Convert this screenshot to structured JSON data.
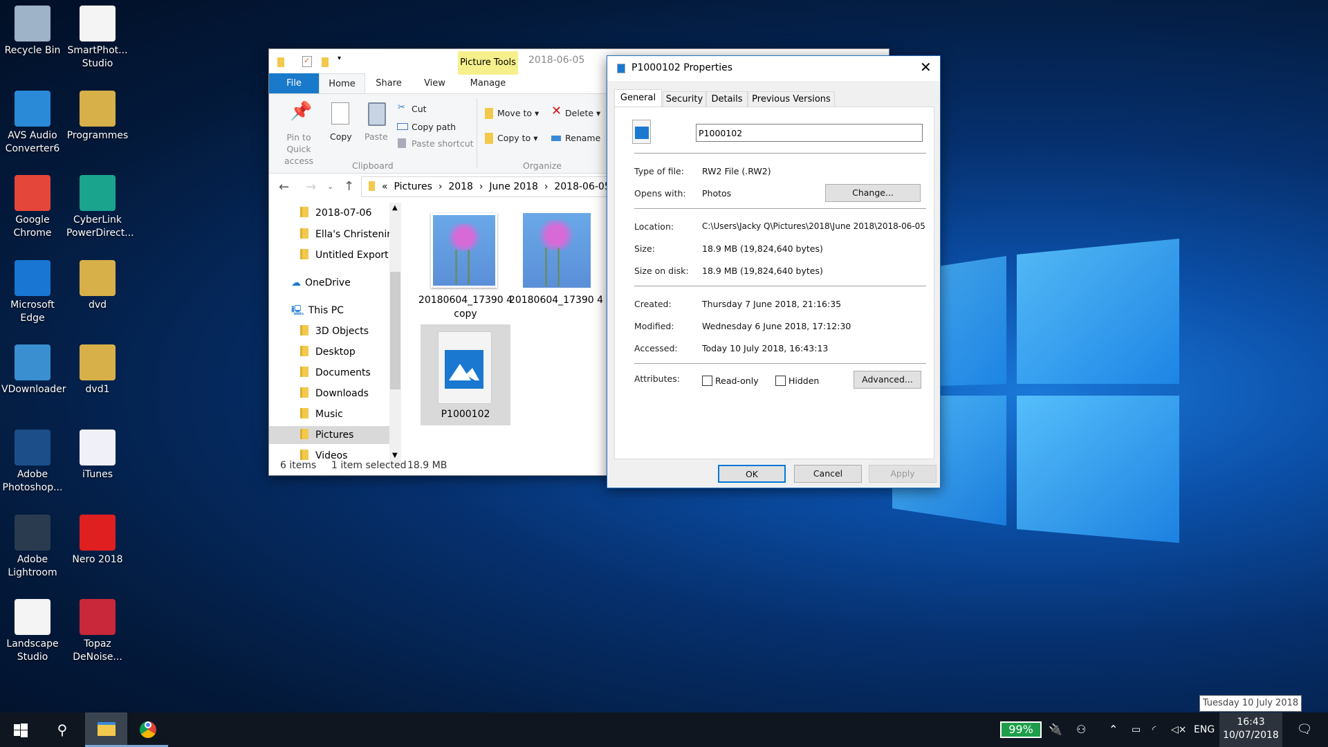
{
  "desktop": {
    "icons": [
      {
        "label": "Recycle Bin",
        "color": "#9fb3c8"
      },
      {
        "label": "SmartPhot... Studio",
        "color": "#f4f4f4"
      },
      {
        "label": "AVS Audio Converter6",
        "color": "#2a8ad8"
      },
      {
        "label": "Programmes",
        "color": "#d8b04a"
      },
      {
        "label": "Google Chrome",
        "color": "#e5463a"
      },
      {
        "label": "CyberLink PowerDirect...",
        "color": "#1aa48e"
      },
      {
        "label": "Microsoft Edge",
        "color": "#1976d2"
      },
      {
        "label": "dvd",
        "color": "#d8b04a"
      },
      {
        "label": "VDownloader",
        "color": "#3a8fd0"
      },
      {
        "label": "dvd1",
        "color": "#d8b04a"
      },
      {
        "label": "Adobe Photoshop...",
        "color": "#1c4f8a"
      },
      {
        "label": "iTunes",
        "color": "#f0f0f8"
      },
      {
        "label": "Adobe Lightroom",
        "color": "#2b3b4f"
      },
      {
        "label": "Nero 2018",
        "color": "#e02020"
      },
      {
        "label": "Landscape Studio",
        "color": "#f4f4f4"
      },
      {
        "label": "Topaz DeNoise...",
        "color": "#c8283a"
      }
    ]
  },
  "explorer": {
    "title": "2018-06-05",
    "context_tab": "Picture Tools",
    "tabs": [
      "File",
      "Home",
      "Share",
      "View",
      "Manage"
    ],
    "ribbon": {
      "pin": "Pin to Quick access",
      "copy": "Copy",
      "paste": "Paste",
      "cut": "Cut",
      "copy_path": "Copy path",
      "paste_shortcut": "Paste shortcut",
      "clipboard": "Clipboard",
      "move_to": "Move to",
      "copy_to": "Copy to",
      "delete": "Delete",
      "rename": "Rename",
      "organize": "Organize"
    },
    "breadcrumb": [
      "Pictures",
      "2018",
      "June 2018",
      "2018-06-05"
    ],
    "nav": [
      "2018-07-06",
      "Ella's Christening",
      "Untitled Export",
      "OneDrive",
      "This PC",
      "3D Objects",
      "Desktop",
      "Documents",
      "Downloads",
      "Music",
      "Pictures",
      "Videos"
    ],
    "files": [
      {
        "name": "20180604_17390 4 copy"
      },
      {
        "name": "20180604_17390 4"
      },
      {
        "name": "P1000102"
      }
    ],
    "status": {
      "count": "6 items",
      "selected": "1 item selected",
      "size": "18.9 MB"
    }
  },
  "dialog": {
    "title": "P1000102 Properties",
    "tabs": [
      "General",
      "Security",
      "Details",
      "Previous Versions"
    ],
    "filename": "P1000102",
    "type_label": "Type of file:",
    "type": "RW2 File (.RW2)",
    "opens_label": "Opens with:",
    "opens": "Photos",
    "change": "Change...",
    "location_label": "Location:",
    "location": "C:\\Users\\Jacky Q\\Pictures\\2018\\June 2018\\2018-06-05",
    "size_label": "Size:",
    "size": "18.9 MB (19,824,640 bytes)",
    "disk_label": "Size on disk:",
    "disk": "18.9 MB (19,824,640 bytes)",
    "created_label": "Created:",
    "created": "Thursday 7 June 2018, 21:16:35",
    "modified_label": "Modified:",
    "modified": "Wednesday 6 June 2018, 17:12:30",
    "accessed_label": "Accessed:",
    "accessed": "Today 10 July 2018, 16:43:13",
    "attr_label": "Attributes:",
    "readonly": "Read-only",
    "hidden": "Hidden",
    "advanced": "Advanced...",
    "ok": "OK",
    "cancel": "Cancel",
    "apply": "Apply"
  },
  "taskbar": {
    "battery": "99%",
    "battery_level": 99,
    "lang": "ENG",
    "time": "16:43",
    "date": "10/07/2018",
    "tooltip": "Tuesday 10 July 2018",
    "accent": "#1e9e4a"
  }
}
